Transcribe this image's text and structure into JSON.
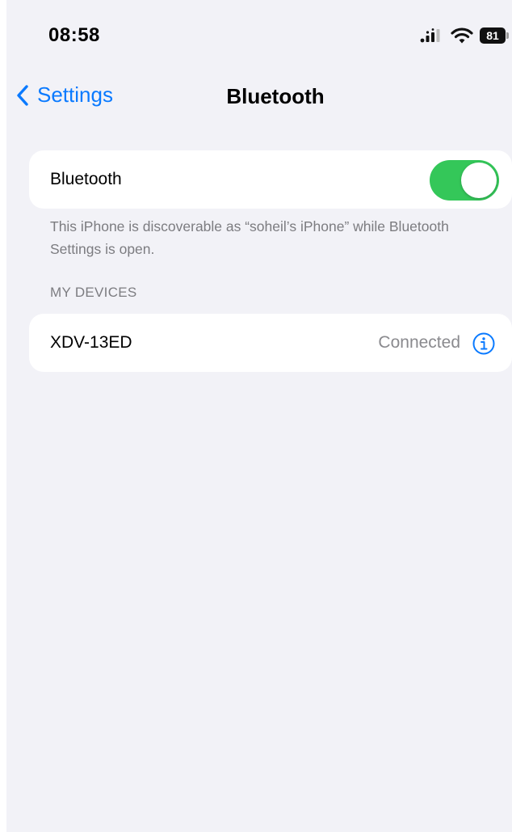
{
  "status_bar": {
    "time": "08:58",
    "battery_level": "81",
    "signal_icon": "cellular-signal-icon",
    "wifi_icon": "wifi-icon"
  },
  "nav": {
    "back_label": "Settings",
    "back_icon": "chevron-left-icon",
    "title": "Bluetooth"
  },
  "bluetooth": {
    "label": "Bluetooth",
    "enabled": true,
    "toggle_color": "#34c759",
    "footnote": "This iPhone is discoverable as “soheil’s iPhone” while Bluetooth Settings is open."
  },
  "my_devices": {
    "header": "MY DEVICES",
    "items": [
      {
        "name": "XDV-13ED",
        "status": "Connected",
        "icon": "info-icon"
      }
    ]
  },
  "colors": {
    "accent": "#0a7aff",
    "background": "#f2f2f7",
    "secondary_text": "#7c7c80"
  }
}
